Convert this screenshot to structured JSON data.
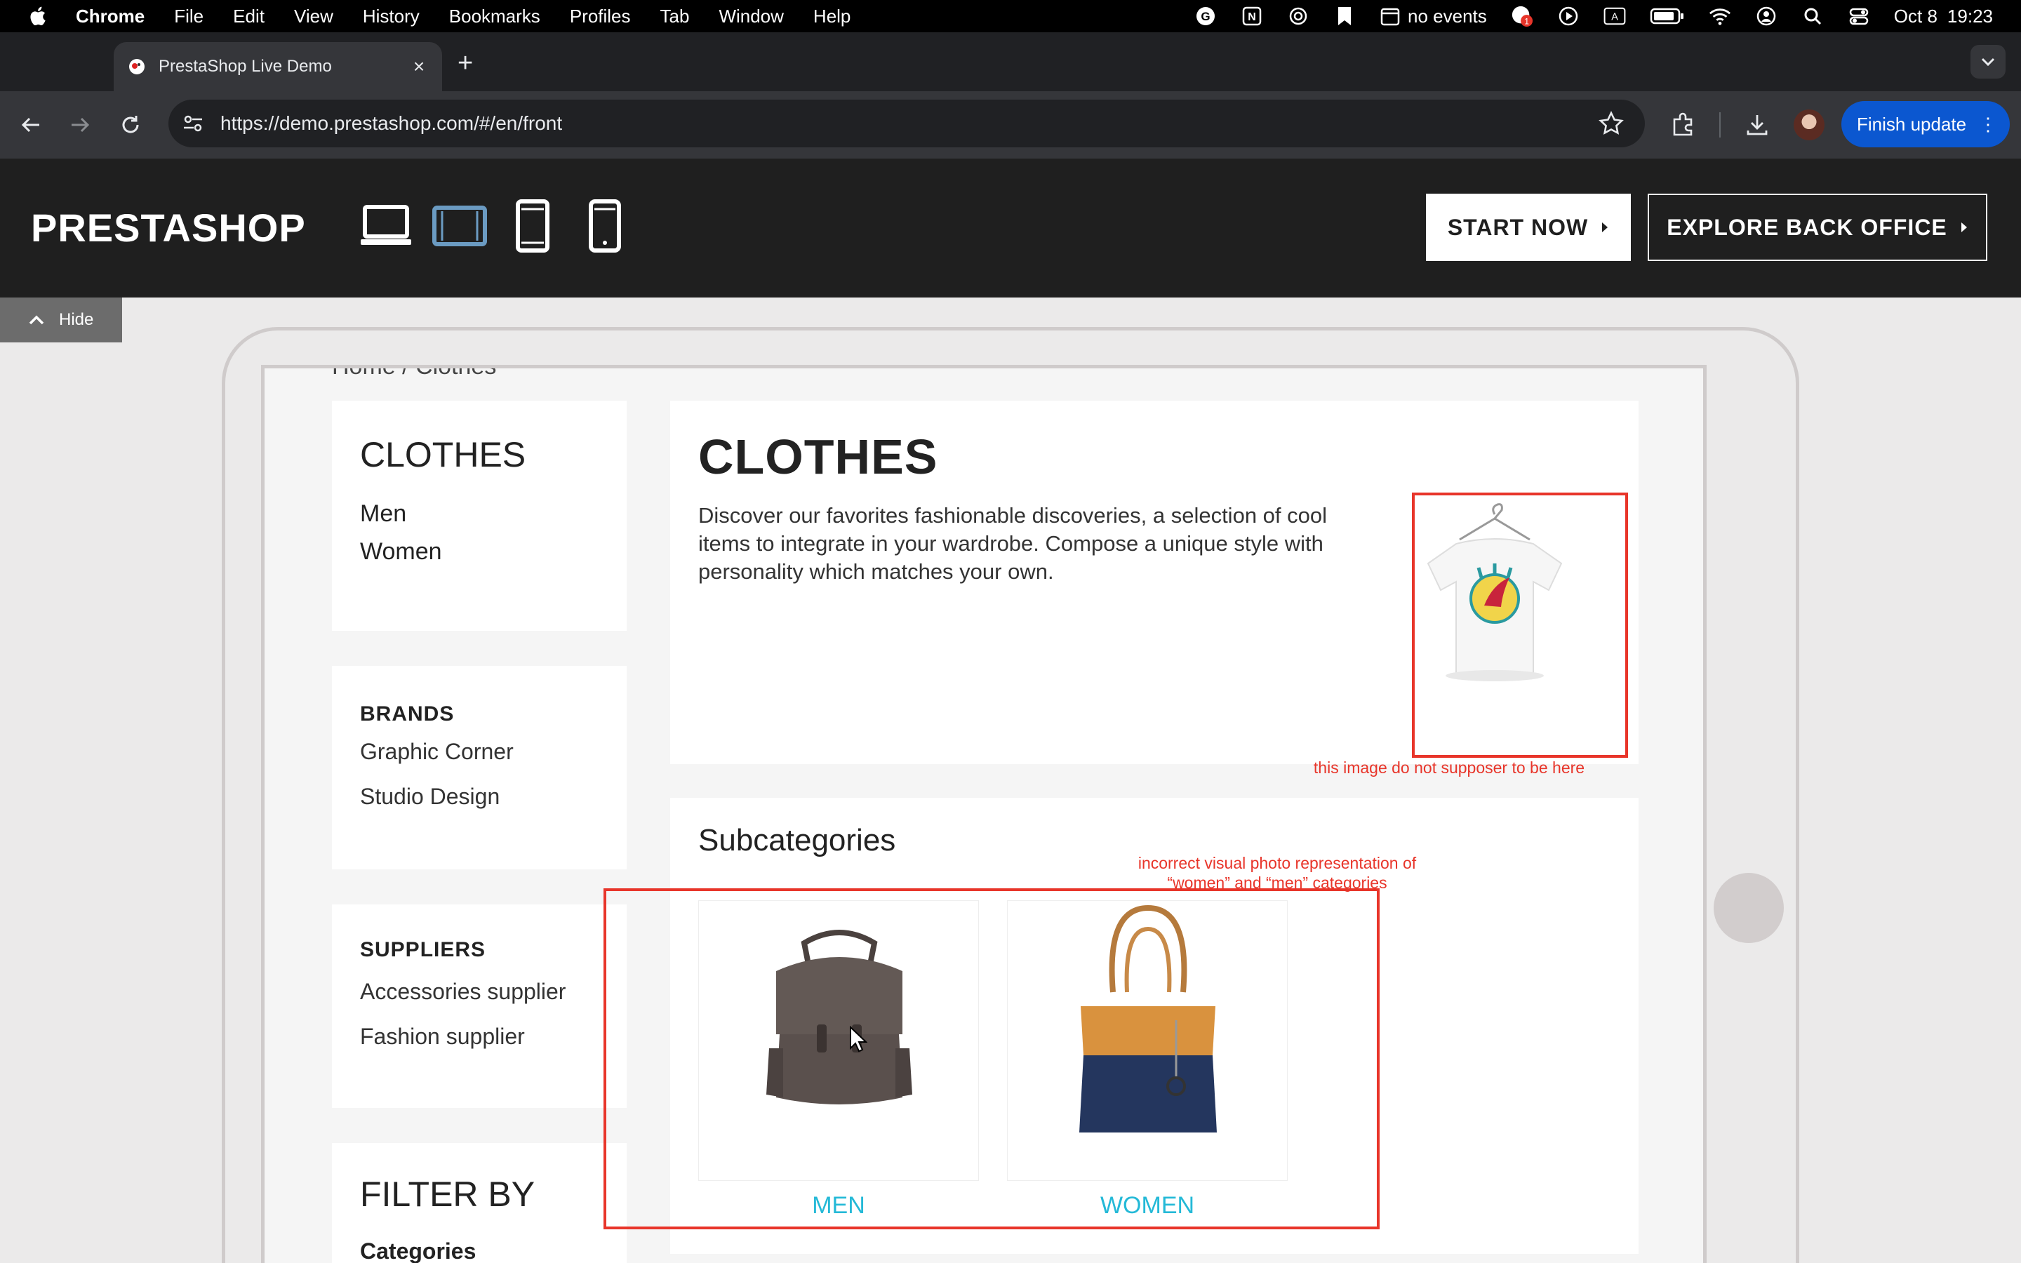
{
  "menubar": {
    "app_name": "Chrome",
    "items": [
      "File",
      "Edit",
      "View",
      "History",
      "Bookmarks",
      "Profiles",
      "Tab",
      "Window",
      "Help"
    ],
    "calendar_text": "no events",
    "date": "Oct 8",
    "time": "19:23",
    "icons": [
      "grammarly-icon",
      "notion-icon",
      "chatgpt-icon",
      "bookmark-icon",
      "calendar-icon",
      "notification-icon",
      "play-icon",
      "keyboard-input-icon",
      "battery-icon",
      "wifi-icon",
      "user-icon",
      "spotlight-search-icon",
      "control-center-icon"
    ],
    "input_source": "A",
    "notification_count": "1"
  },
  "browser": {
    "tab_title": "PrestaShop Live Demo",
    "url": "https://demo.prestashop.com/#/en/front",
    "finish_update_label": "Finish update"
  },
  "demo_header": {
    "logo": "PRESTASHOP",
    "start_now": "START NOW",
    "explore_back_office": "EXPLORE BACK OFFICE",
    "hide_label": "Hide",
    "devices": [
      "desktop",
      "tablet-landscape",
      "tablet-portrait",
      "mobile"
    ],
    "active_device": "tablet-landscape"
  },
  "store": {
    "breadcrumb": "Home  /  Clothes",
    "sidebar": {
      "category_title": "CLOTHES",
      "category_links": [
        "Men",
        "Women"
      ],
      "brands_title": "BRANDS",
      "brands": [
        "Graphic Corner",
        "Studio Design"
      ],
      "suppliers_title": "SUPPLIERS",
      "suppliers": [
        "Accessories supplier",
        "Fashion supplier"
      ],
      "filter_title": "FILTER BY",
      "filter_categories": "Categories"
    },
    "main": {
      "title": "CLOTHES",
      "description": "Discover our favorites fashionable discoveries, a selection of cool items to integrate in your wardrobe. Compose a unique style with personality which matches your own.",
      "subcategories_title": "Subcategories",
      "subcategories": [
        "MEN",
        "WOMEN"
      ]
    }
  },
  "annotations": {
    "image_note": "this image do not supposer to be here",
    "subcategory_note_line1": "incorrect visual  photo representation of",
    "subcategory_note_line2": "“women” and “men” categories",
    "color": "#e8352a"
  },
  "colors": {
    "link_accent": "#24b9d7",
    "update_button": "#0b57d0",
    "header_bg": "#1f1f1f"
  }
}
